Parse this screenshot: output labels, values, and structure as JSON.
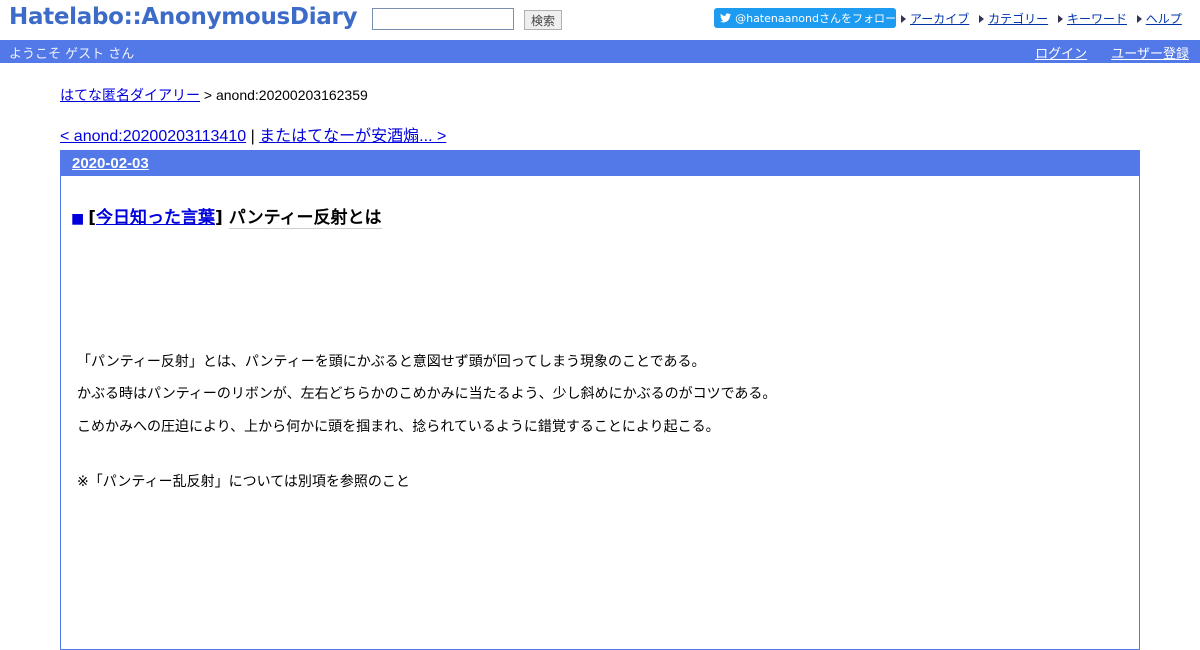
{
  "header": {
    "logo": "Hatelabo::AnonymousDiary",
    "search_value": "",
    "search_button": "検索",
    "follow_button": "@hatenaanondさんをフォロー",
    "links": [
      "アーカイブ",
      "カテゴリー",
      "キーワード",
      "ヘルプ"
    ]
  },
  "userbar": {
    "welcome": "ようこそ ゲスト さん",
    "login": "ログイン",
    "register": "ユーザー登録"
  },
  "breadcrumb": {
    "home": "はてな匿名ダイアリー",
    "separator": " > ",
    "current": "anond:20200203162359"
  },
  "pager": {
    "prev": "< anond:20200203113410",
    "separator": " | ",
    "next": "またはてなーが安酒煽... >"
  },
  "entry": {
    "date": "2020-02-03",
    "title_square": "■",
    "category_open": "[",
    "category": "今日知った言葉",
    "category_close": "]",
    "title": "パンティー反射とは",
    "paragraphs": [
      "「パンティー反射」とは、パンティーを頭にかぶると意図せず頭が回ってしまう現象のことである。",
      "かぶる時はパンティーのリボンが、左右どちらかのこめかみに当たるよう、少し斜めにかぶるのがコツである。",
      "こめかみへの圧迫により、上から何かに頭を掴まれ、捻られているように錯覚することにより起こる。",
      "※「パンティー乱反射」については別項を参照のこと"
    ]
  },
  "colors": {
    "accent": "#5279e7",
    "twitter": "#1d9bf0",
    "logo": "#3d6bc8",
    "link": "#0000dd"
  }
}
